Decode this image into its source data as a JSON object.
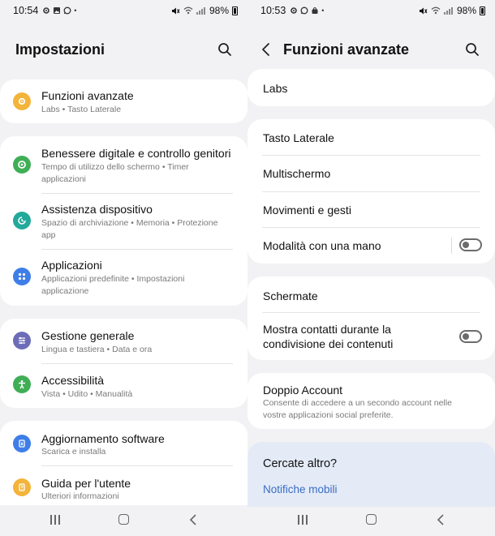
{
  "left": {
    "status": {
      "time": "10:54",
      "battery": "98%"
    },
    "title": "Impostazioni",
    "items": [
      {
        "title": "Funzioni avanzate",
        "sub": "Labs • Tasto Laterale",
        "icon": "gear-puzzle-icon",
        "color": "#f3b43a"
      },
      {
        "title": "Benessere digitale e controllo genitori",
        "sub": "Tempo di utilizzo dello schermo • Timer applicazioni",
        "icon": "wellbeing-icon",
        "color": "#3fae55"
      },
      {
        "title": "Assistenza dispositivo",
        "sub": "Spazio di archiviazione • Memoria • Protezione app",
        "icon": "device-care-icon",
        "color": "#22a99a"
      },
      {
        "title": "Applicazioni",
        "sub": "Applicazioni predefinite • Impostazioni applicazione",
        "icon": "apps-grid-icon",
        "color": "#3f7ee8"
      },
      {
        "title": "Gestione generale",
        "sub": "Lingua e tastiera • Data e ora",
        "icon": "sliders-icon",
        "color": "#6c6cb8"
      },
      {
        "title": "Accessibilità",
        "sub": "Vista • Udito • Manualità",
        "icon": "accessibility-icon",
        "color": "#3fae55"
      },
      {
        "title": "Aggiornamento software",
        "sub": "Scarica e installa",
        "icon": "software-update-icon",
        "color": "#3f7ee8"
      },
      {
        "title": "Guida per l'utente",
        "sub": "Ulteriori informazioni",
        "icon": "user-guide-icon",
        "color": "#f3b43a"
      }
    ]
  },
  "right": {
    "status": {
      "time": "10:53",
      "battery": "98%"
    },
    "title": "Funzioni avanzate",
    "labs": "Labs",
    "group1": [
      "Tasto Laterale",
      "Multischermo",
      "Movimenti e gesti",
      "Modalità con una mano"
    ],
    "schermate": "Schermate",
    "mostra": "Mostra contatti durante la condivisione dei contenuti",
    "doppio": {
      "title": "Doppio Account",
      "sub": "Consente di accedere a un secondo account nelle vostre applicazioni social preferite."
    },
    "cercate": "Cercate altro?",
    "notifiche": "Notifiche mobili",
    "toggles": {
      "mano": false,
      "mostra": false
    }
  }
}
